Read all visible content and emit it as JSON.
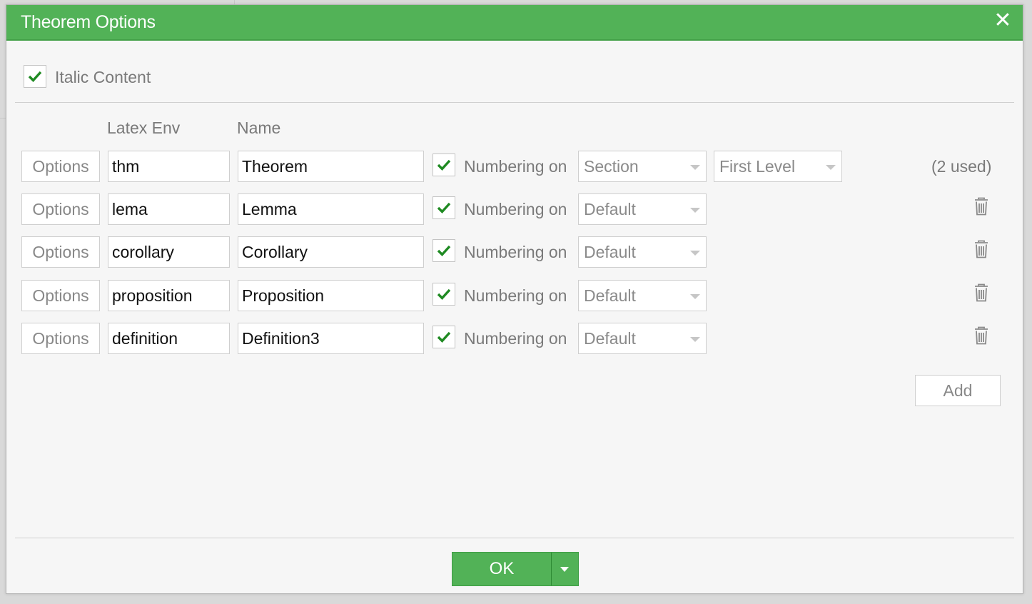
{
  "dialog": {
    "title": "Theorem Options",
    "close_icon": "close-icon"
  },
  "italic": {
    "checked": true,
    "label": "Italic Content"
  },
  "table": {
    "headers": {
      "latex_env": "Latex Env",
      "name": "Name"
    },
    "rows": [
      {
        "options_label": "Options",
        "env": "thm",
        "name": "Theorem",
        "numbered": true,
        "numbering_label": "Numbering on",
        "numbering_value": "Section",
        "level_value": "First Level",
        "note": "(2 used)"
      },
      {
        "options_label": "Options",
        "env": "lema",
        "name": "Lemma",
        "numbered": true,
        "numbering_label": "Numbering on",
        "numbering_value": "Default"
      },
      {
        "options_label": "Options",
        "env": "corollary",
        "name": "Corollary",
        "numbered": true,
        "numbering_label": "Numbering on",
        "numbering_value": "Default"
      },
      {
        "options_label": "Options",
        "env": "proposition",
        "name": "Proposition",
        "numbered": true,
        "numbering_label": "Numbering on",
        "numbering_value": "Default"
      },
      {
        "options_label": "Options",
        "env": "definition",
        "name": "Definition3",
        "numbered": true,
        "numbering_label": "Numbering on",
        "numbering_value": "Default"
      }
    ],
    "add_label": "Add"
  },
  "footer": {
    "ok_label": "OK"
  },
  "colors": {
    "title_bar": "#52b257",
    "check": "#1f8a22"
  }
}
